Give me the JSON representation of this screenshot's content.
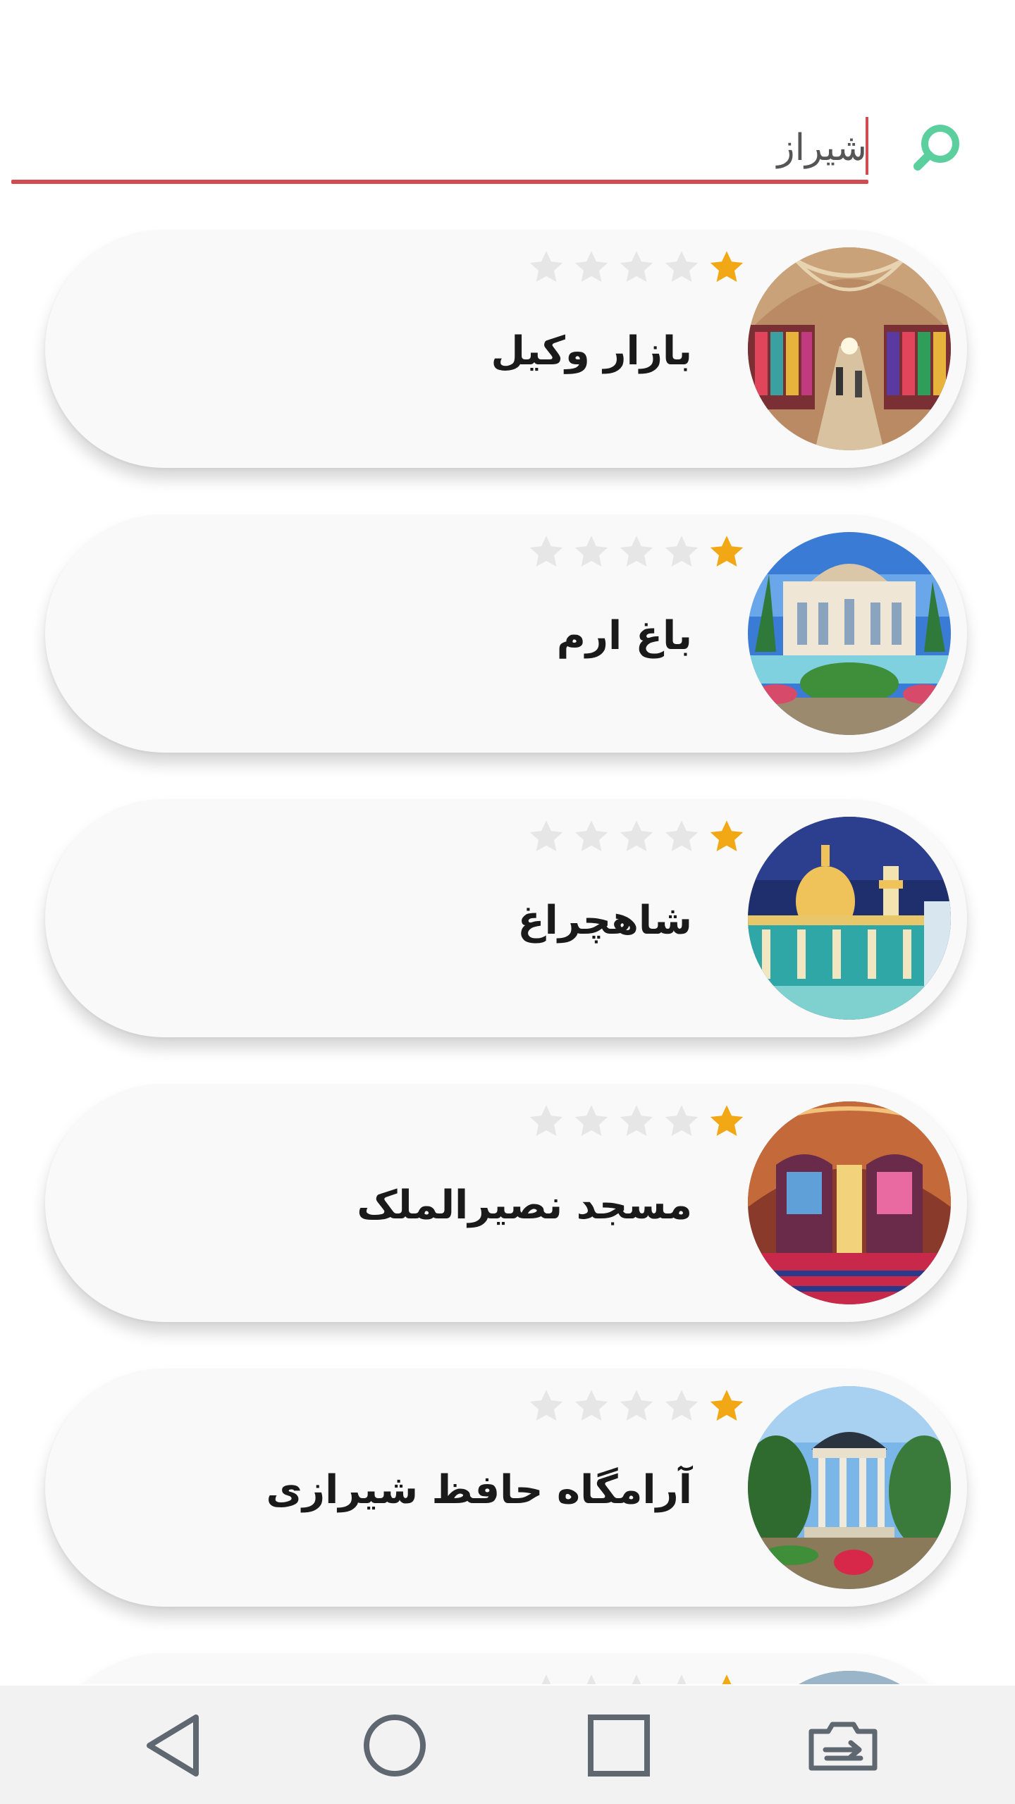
{
  "search": {
    "query": "شیراز",
    "icon": "search-icon",
    "accent_color": "#d14c52",
    "icon_color": "#5ccf9e"
  },
  "rating_colors": {
    "filled": "#f2a814",
    "empty": "#e6e6e6"
  },
  "places": [
    {
      "name": "بازار وکیل",
      "rating": 1,
      "max_rating": 5,
      "image": "bazaar-photo"
    },
    {
      "name": "باغ ارم",
      "rating": 1,
      "max_rating": 5,
      "image": "garden-photo"
    },
    {
      "name": "شاهچراغ",
      "rating": 1,
      "max_rating": 5,
      "image": "shrine-photo"
    },
    {
      "name": "مسجد نصیرالملک",
      "rating": 1,
      "max_rating": 5,
      "image": "mosque-photo"
    },
    {
      "name": "آرامگاه حافظ شیرازی",
      "rating": 1,
      "max_rating": 5,
      "image": "tomb-photo"
    },
    {
      "name": "",
      "rating": 1,
      "max_rating": 5,
      "image": "partial-photo"
    }
  ],
  "navbar": {
    "buttons": [
      {
        "icon": "back-triangle-icon"
      },
      {
        "icon": "home-circle-icon"
      },
      {
        "icon": "recents-square-icon"
      },
      {
        "icon": "screen-switch-icon"
      }
    ]
  }
}
